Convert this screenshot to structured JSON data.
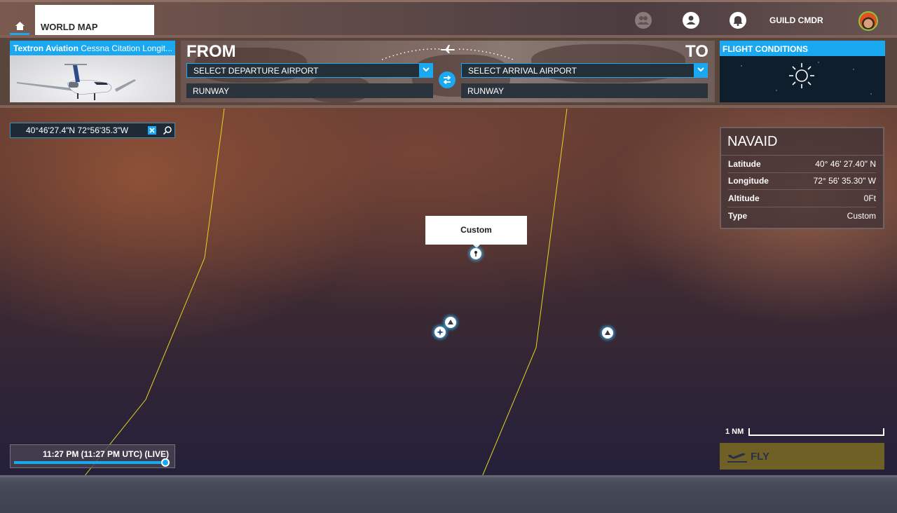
{
  "topbar": {
    "home_icon": "home-icon",
    "tab_label": "WORLD MAP",
    "icons": [
      "friends-icon",
      "profile-icon",
      "notifications-bell-icon"
    ],
    "username": "GUILD CMDR",
    "avatar": "user-avatar"
  },
  "aircraft": {
    "manufacturer": "Textron Aviation",
    "model": "Cessna Citation Longit..."
  },
  "route": {
    "from_label": "FROM",
    "to_label": "TO",
    "departure_placeholder": "SELECT DEPARTURE AIRPORT",
    "arrival_placeholder": "SELECT ARRIVAL AIRPORT",
    "departure_runway": "RUNWAY",
    "arrival_runway": "RUNWAY",
    "swap_icon": "swap-icon"
  },
  "flight_conditions": {
    "title": "FLIGHT CONDITIONS",
    "weather_icon": "sun-icon"
  },
  "search": {
    "value": "40°46'27.4\"N 72°56'35.3\"W",
    "clear_icon": "clear-icon",
    "search_icon": "search-icon"
  },
  "navaid": {
    "title": "NAVAID",
    "rows": [
      {
        "key": "Latitude",
        "value": "40° 46' 27.40\" N"
      },
      {
        "key": "Longitude",
        "value": "72° 56' 35.30\" W"
      },
      {
        "key": "Altitude",
        "value": "0Ft"
      },
      {
        "key": "Type",
        "value": "Custom"
      }
    ]
  },
  "map": {
    "tooltip": "Custom",
    "markers": [
      "custom-pin",
      "vor-marker",
      "waypoint-triangle",
      "waypoint-triangle"
    ]
  },
  "time": {
    "label": "11:27 PM (11:27 PM UTC) (LIVE)",
    "progress": 1.0
  },
  "scale": {
    "label": "1 NM"
  },
  "fly": {
    "label": "FLY"
  },
  "colors": {
    "accent": "#1aa9f0",
    "fly_button": "#6f6126",
    "route_line": "#e8d820"
  }
}
